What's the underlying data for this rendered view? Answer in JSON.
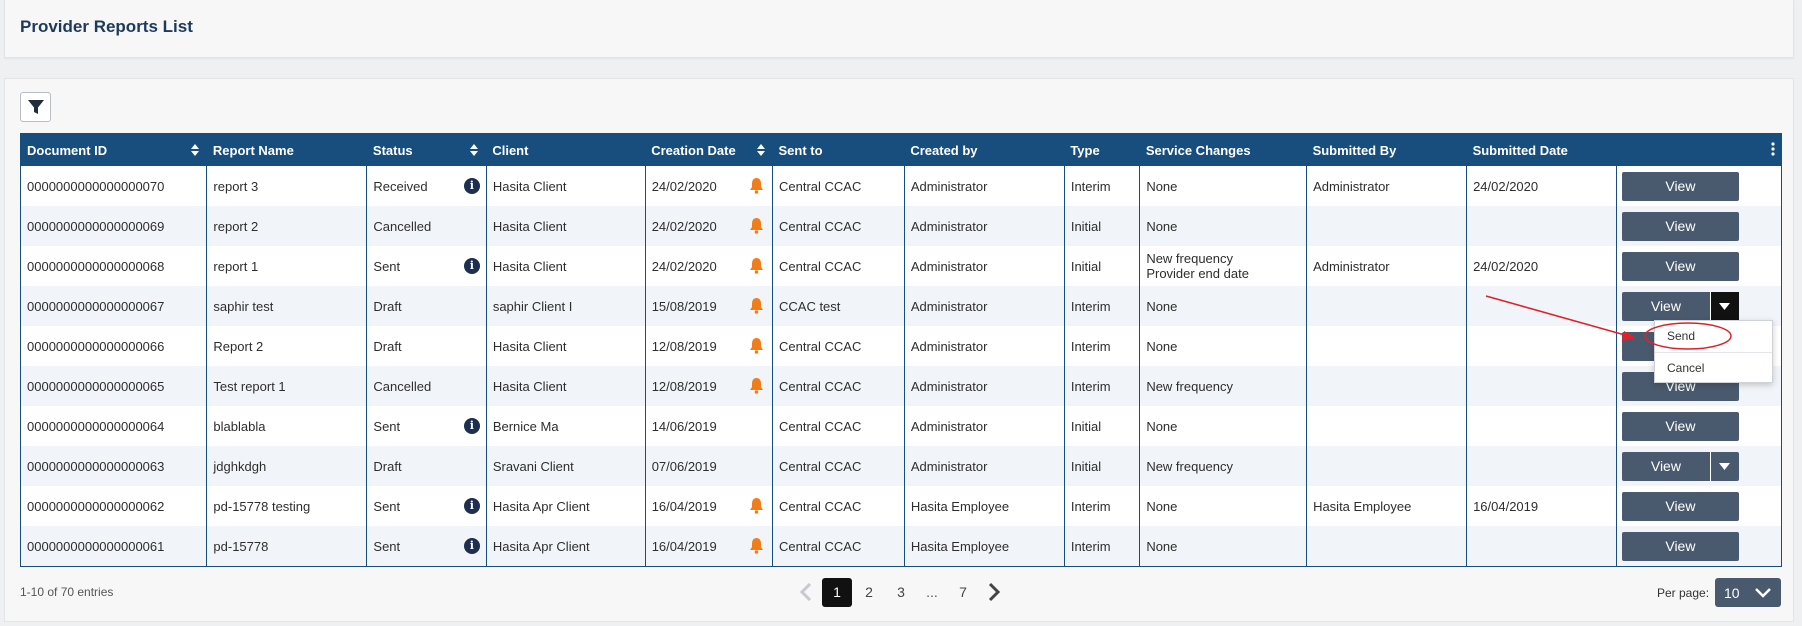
{
  "page": {
    "title": "Provider Reports List"
  },
  "table": {
    "columns": [
      "Document ID",
      "Report Name",
      "Status",
      "Client",
      "Creation Date",
      "Sent to",
      "Created by",
      "Type",
      "Service Changes",
      "Submitted By",
      "Submitted Date",
      ""
    ],
    "rows": [
      {
        "doc_id": "0000000000000000070",
        "name": "report 3",
        "status": "Received",
        "client": "Hasita Client",
        "created": "24/02/2020",
        "sent_to": "Central CCAC",
        "created_by": "Administrator",
        "type": "Interim",
        "changes": [
          "None"
        ],
        "submitted_by": "Administrator",
        "submitted_date": "24/02/2020",
        "info": true,
        "bell": true,
        "action": "View",
        "split": false
      },
      {
        "doc_id": "0000000000000000069",
        "name": "report 2",
        "status": "Cancelled",
        "client": "Hasita Client",
        "created": "24/02/2020",
        "sent_to": "Central CCAC",
        "created_by": "Administrator",
        "type": "Initial",
        "changes": [
          "None"
        ],
        "submitted_by": "",
        "submitted_date": "",
        "info": false,
        "bell": true,
        "action": "View",
        "split": false
      },
      {
        "doc_id": "0000000000000000068",
        "name": "report 1",
        "status": "Sent",
        "client": "Hasita Client",
        "created": "24/02/2020",
        "sent_to": "Central CCAC",
        "created_by": "Administrator",
        "type": "Initial",
        "changes": [
          "New frequency",
          "Provider end date"
        ],
        "submitted_by": "Administrator",
        "submitted_date": "24/02/2020",
        "info": true,
        "bell": true,
        "action": "View",
        "split": false
      },
      {
        "doc_id": "0000000000000000067",
        "name": "saphir test",
        "status": "Draft",
        "client": "saphir Client I",
        "created": "15/08/2019",
        "sent_to": "CCAC test",
        "created_by": "Administrator",
        "type": "Interim",
        "changes": [
          "None"
        ],
        "submitted_by": "",
        "submitted_date": "",
        "info": false,
        "bell": true,
        "action": "View",
        "split": true,
        "active": true
      },
      {
        "doc_id": "0000000000000000066",
        "name": "Report 2",
        "status": "Draft",
        "client": "Hasita Client",
        "created": "12/08/2019",
        "sent_to": "Central CCAC",
        "created_by": "Administrator",
        "type": "Interim",
        "changes": [
          "None"
        ],
        "submitted_by": "",
        "submitted_date": "",
        "info": false,
        "bell": true,
        "action": "View",
        "split": false
      },
      {
        "doc_id": "0000000000000000065",
        "name": "Test report 1",
        "status": "Cancelled",
        "client": "Hasita Client",
        "created": "12/08/2019",
        "sent_to": "Central CCAC",
        "created_by": "Administrator",
        "type": "Interim",
        "changes": [
          "New frequency"
        ],
        "submitted_by": "",
        "submitted_date": "",
        "info": false,
        "bell": true,
        "action": "View",
        "split": false
      },
      {
        "doc_id": "0000000000000000064",
        "name": "blablabla",
        "status": "Sent",
        "client": "Bernice Ma",
        "created": "14/06/2019",
        "sent_to": "Central CCAC",
        "created_by": "Administrator",
        "type": "Initial",
        "changes": [
          "None"
        ],
        "submitted_by": "",
        "submitted_date": "",
        "info": true,
        "bell": false,
        "action": "View",
        "split": false
      },
      {
        "doc_id": "0000000000000000063",
        "name": "jdghkdgh",
        "status": "Draft",
        "client": "Sravani Client",
        "created": "07/06/2019",
        "sent_to": "Central CCAC",
        "created_by": "Administrator",
        "type": "Initial",
        "changes": [
          "New frequency"
        ],
        "submitted_by": "",
        "submitted_date": "",
        "info": false,
        "bell": false,
        "action": "View",
        "split": true
      },
      {
        "doc_id": "0000000000000000062",
        "name": "pd-15778 testing",
        "status": "Sent",
        "client": "Hasita Apr Client",
        "created": "16/04/2019",
        "sent_to": "Central CCAC",
        "created_by": "Hasita Employee",
        "type": "Interim",
        "changes": [
          "None"
        ],
        "submitted_by": "Hasita Employee",
        "submitted_date": "16/04/2019",
        "info": true,
        "bell": true,
        "action": "View",
        "split": false
      },
      {
        "doc_id": "0000000000000000061",
        "name": "pd-15778",
        "status": "Sent",
        "client": "Hasita Apr Client",
        "created": "16/04/2019",
        "sent_to": "Central CCAC",
        "created_by": "Hasita Employee",
        "type": "Interim",
        "changes": [
          "None"
        ],
        "submitted_by": "",
        "submitted_date": "",
        "info": true,
        "bell": true,
        "action": "View",
        "split": false
      }
    ]
  },
  "dropdown": {
    "items": [
      "Send",
      "Cancel"
    ]
  },
  "footer": {
    "entries": "1-10 of 70 entries",
    "pages": [
      "1",
      "2",
      "3",
      "...",
      "7"
    ],
    "current_page": "1",
    "per_page_label": "Per page:",
    "per_page_value": "10"
  },
  "colors": {
    "header": "#174e7e",
    "button": "#4a5a6e",
    "bell": "#f07d1a",
    "annotation": "#e0202a"
  }
}
